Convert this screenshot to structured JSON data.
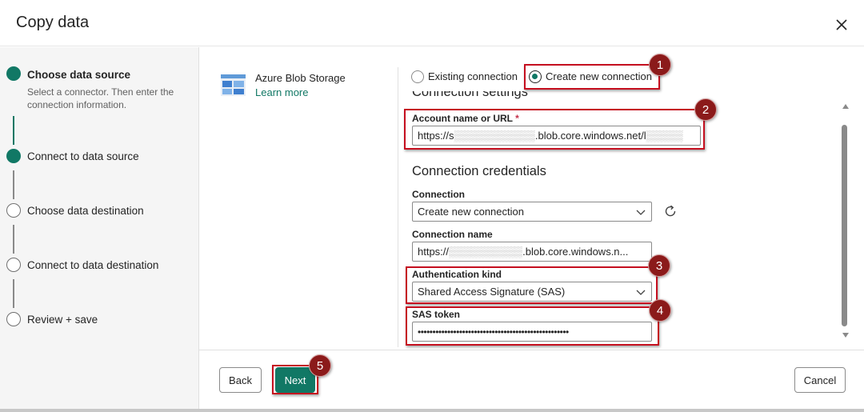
{
  "dialog": {
    "title": "Copy data",
    "close_icon": "close-icon"
  },
  "steps": [
    {
      "label": "Choose data source",
      "sublabel": "Select a connector. Then enter the connection information.",
      "state": "active"
    },
    {
      "label": "Connect to data source",
      "state": "done"
    },
    {
      "label": "Choose data destination",
      "state": "todo"
    },
    {
      "label": "Connect to data destination",
      "state": "todo"
    },
    {
      "label": "Review + save",
      "state": "todo"
    }
  ],
  "connector": {
    "name": "Azure Blob Storage",
    "link": "Learn more",
    "icon": "azure-blob-storage-icon"
  },
  "connection_mode": {
    "options": [
      "Existing connection",
      "Create new connection"
    ],
    "selected": "Create new connection"
  },
  "connection_settings": {
    "heading": "Connection settings",
    "account_label": "Account name or URL",
    "required_mark": "*",
    "account_value_prefix": "https://s",
    "account_value_suffix": ".blob.core.windows.net/l"
  },
  "credentials": {
    "heading": "Connection credentials",
    "connection_label": "Connection",
    "connection_value": "Create new connection",
    "connection_name_label": "Connection name",
    "connection_name_prefix": "https://",
    "connection_name_suffix": ".blob.core.windows.n...",
    "auth_label": "Authentication kind",
    "auth_value": "Shared Access Signature (SAS)",
    "sas_label": "SAS token",
    "sas_value": "•••••••••••••••••••••••••••••••••••••••••••••••••••"
  },
  "footer": {
    "back_label": "Back",
    "next_label": "Next",
    "cancel_label": "Cancel"
  },
  "callouts": [
    "1",
    "2",
    "3",
    "4",
    "5"
  ],
  "colors": {
    "accent": "#117865",
    "callout_red": "#c50f1f",
    "badge_fill": "#8b1a1a"
  }
}
